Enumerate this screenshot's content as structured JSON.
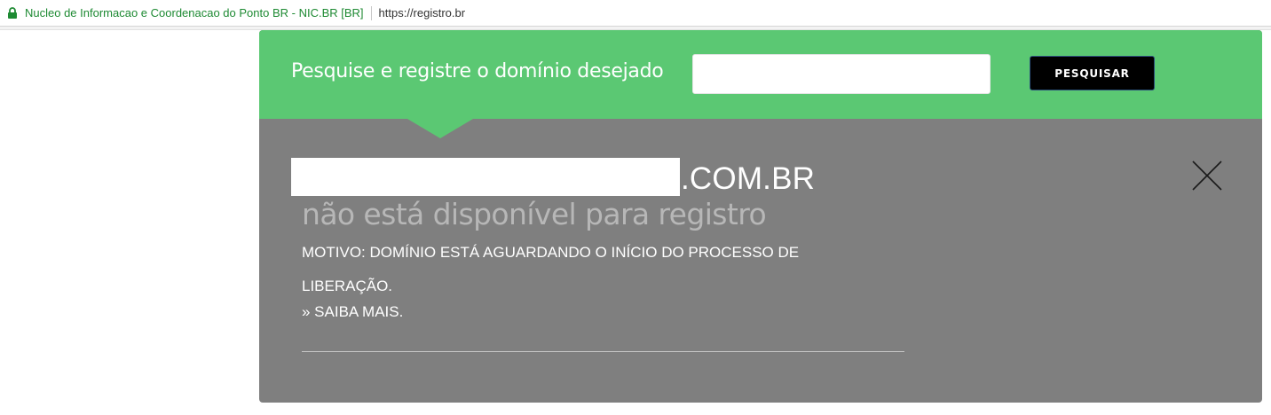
{
  "browser": {
    "site_identity": "Nucleo de Informacao e Coordenacao do Ponto BR - NIC.BR [BR]",
    "url": "https://registro.br",
    "icon": "lock-icon"
  },
  "search": {
    "label": "Pesquise e registre o domínio desejado",
    "input_value": "",
    "button_label": "PESQUISAR"
  },
  "result": {
    "domain_suffix": ".COM.BR",
    "status": "não está disponível para registro",
    "reason": "MOTIVO: DOMÍNIO ESTÁ AGUARDANDO O INÍCIO DO PROCESSO DE LIBERAÇÃO.",
    "learn_more": "» SAIBA MAIS.",
    "close_icon": "close-icon"
  },
  "colors": {
    "green": "#5bc873",
    "panel_gray": "#7f7f7f",
    "button_black": "#000000"
  }
}
